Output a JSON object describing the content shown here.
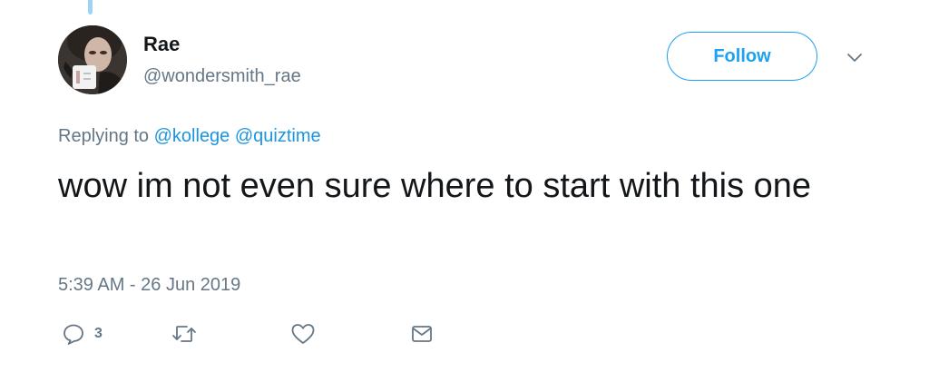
{
  "tweet": {
    "display_name": "Rae",
    "username": "@wondersmith_rae",
    "follow_label": "Follow",
    "replying_prefix": "Replying to",
    "replying_to": [
      "@kollege",
      "@quiztime"
    ],
    "text": "wow im not even sure where to start with this one",
    "timestamp": "5:39 AM - 26 Jun 2019",
    "reply_count": "3"
  },
  "icons": {
    "reply": "reply-icon",
    "retweet": "retweet-icon",
    "like": "heart-icon",
    "message": "envelope-icon",
    "more": "chevron-down-icon"
  },
  "colors": {
    "accent": "#1da1f2",
    "mention": "#1b95e0",
    "secondary_text": "#657786",
    "primary_text": "#14171a",
    "icon": "#657786"
  }
}
